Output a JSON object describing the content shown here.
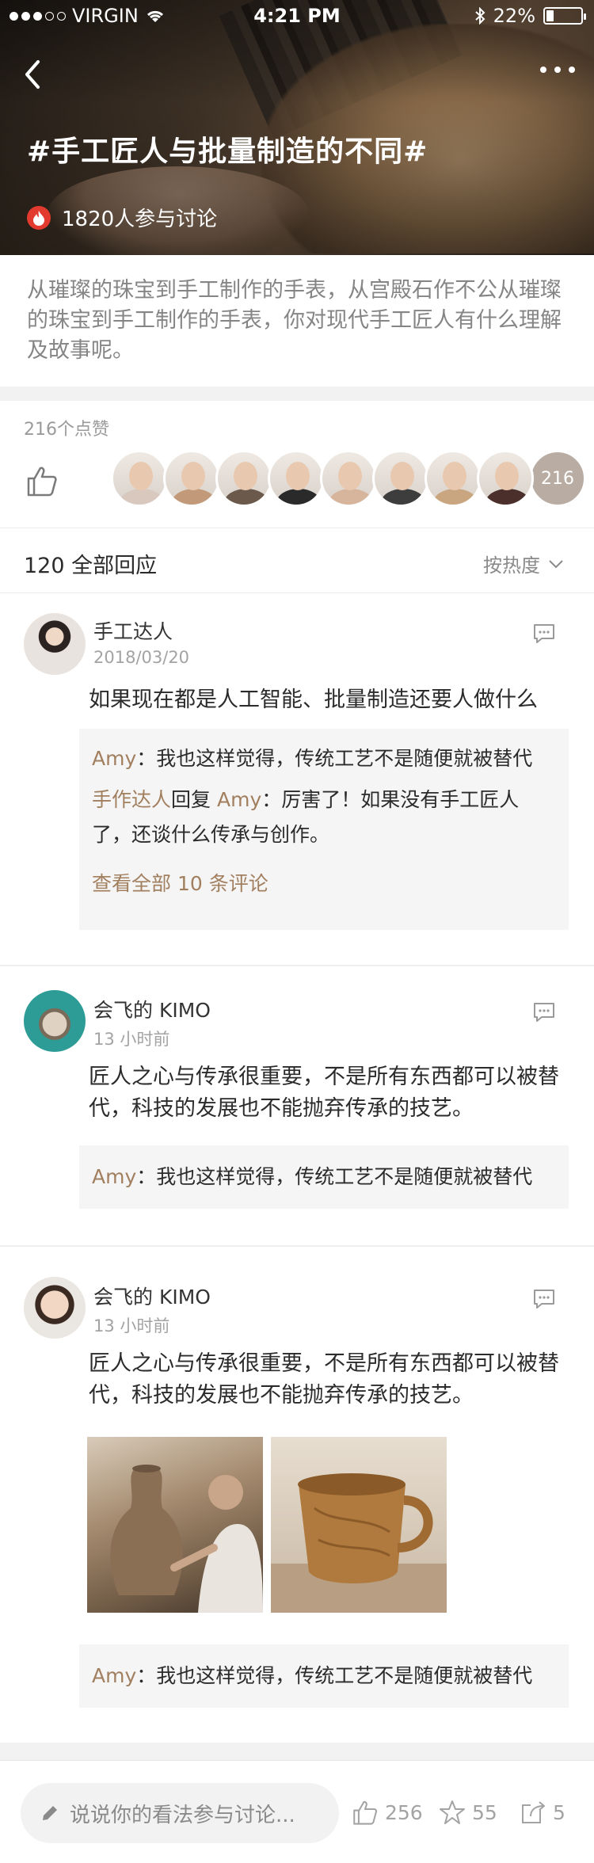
{
  "status_bar": {
    "carrier": "VIRGIN",
    "time": "4:21 PM",
    "battery": "22%",
    "battery_level": 0.22
  },
  "hero": {
    "title": "#手工匠人与批量制造的不同#",
    "participants": "1820人参与讨论"
  },
  "intro": "从璀璨的珠宝到手工制作的手表，从宫殿石作不公从璀璨的珠宝到手工制作的手表，你对现代手工匠人有什么理解及故事呢。",
  "likes": {
    "label": "216个点赞",
    "count_badge": "216",
    "avatar_colors": [
      "#d9c8bd",
      "#c29a79",
      "#6b5a4c",
      "#2a2a2a",
      "#d7b49c",
      "#3d3d3d",
      "#c9a67f",
      "#4a2f2a"
    ]
  },
  "replies_header": {
    "title": "120 全部回应",
    "sort_label": "按热度"
  },
  "comments": [
    {
      "name": "手工达人",
      "time": "2018/03/20",
      "text": "如果现在都是人工智能、批量制造还要人做什么",
      "replies": [
        {
          "author": "Amy",
          "sep": "：",
          "text": "我也这样觉得，传统工艺不是随便就被替代"
        }
      ],
      "reply2": {
        "author": "手作达人",
        "mid": "回复",
        "target": "Amy",
        "text": "：厉害了！如果没有手工匠人了，还谈什么传承与创作。"
      },
      "view_all": "查看全部 10 条评论"
    },
    {
      "name": "会飞的 KIMO",
      "time": "13 小时前",
      "text": "匠人之心与传承很重要，不是所有东西都可以被替代，科技的发展也不能抛弃传承的技艺。",
      "replies": [
        {
          "author": "Amy",
          "sep": "：",
          "text": "我也这样觉得，传统工艺不是随便就被替代"
        }
      ]
    },
    {
      "name": "会飞的 KIMO",
      "time": "13 小时前",
      "text": "匠人之心与传承很重要，不是所有东西都可以被替代，科技的发展也不能抛弃传承的技艺。",
      "replies": [
        {
          "author": "Amy",
          "sep": "：",
          "text": "我也这样觉得，传统工艺不是随便就被替代"
        }
      ]
    }
  ],
  "bottom_bar": {
    "input_placeholder": "说说你的看法参与讨论...",
    "likes": "256",
    "favorites": "55",
    "shares": "5"
  },
  "icons": {
    "back": "back-chevron-icon",
    "more": "more-dots-icon",
    "fire": "fire-icon",
    "thumb": "thumb-up-icon",
    "chevron": "chevron-down-icon",
    "comment": "comment-bubble-icon",
    "pencil": "pencil-icon",
    "star": "star-icon",
    "share": "share-icon"
  }
}
